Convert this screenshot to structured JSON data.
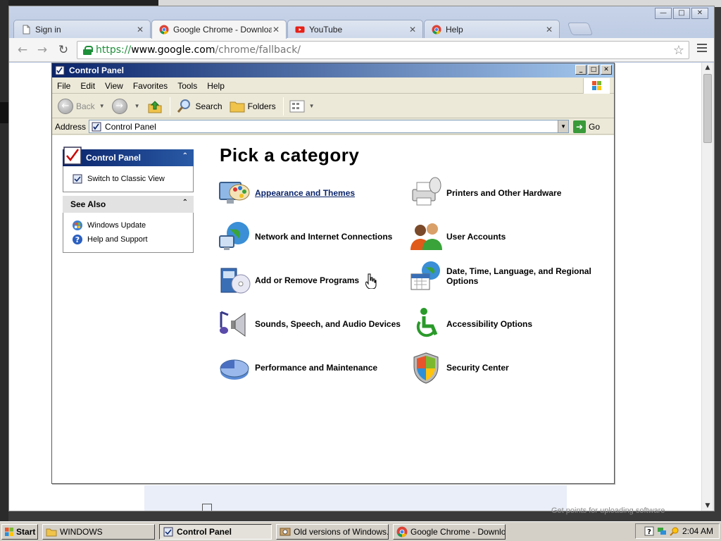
{
  "browser": {
    "tabs": [
      {
        "title": "Sign in",
        "icon": "page-icon",
        "active": false
      },
      {
        "title": "Google Chrome - Download the Fast",
        "icon": "chrome-icon",
        "active": true
      },
      {
        "title": "YouTube",
        "icon": "youtube-icon",
        "active": false
      },
      {
        "title": "Help",
        "icon": "chrome-icon",
        "active": false
      }
    ],
    "window_controls": {
      "minimize": "—",
      "maximize": "□",
      "close": "✕"
    },
    "url": {
      "scheme": "https://",
      "host": "www.google.com",
      "path": "/chrome/fallback/"
    },
    "bg_text": "Get points for uploading software"
  },
  "cp": {
    "title": "Control Panel",
    "menu": [
      "File",
      "Edit",
      "View",
      "Favorites",
      "Tools",
      "Help"
    ],
    "toolbar": {
      "back": "Back",
      "search": "Search",
      "folders": "Folders"
    },
    "address_label": "Address",
    "address_value": "Control Panel",
    "go_label": "Go",
    "taskpane": {
      "cp_title": "Control Panel",
      "switch": "Switch to Classic View",
      "see_also_title": "See Also",
      "see_also": [
        "Windows Update",
        "Help and Support"
      ]
    },
    "heading": "Pick a category",
    "categories": [
      {
        "label": "Appearance and Themes",
        "icon": "appearance-themes-icon"
      },
      {
        "label": "Printers and Other Hardware",
        "icon": "printer-icon"
      },
      {
        "label": "Network and Internet Connections",
        "icon": "network-globe-icon"
      },
      {
        "label": "User Accounts",
        "icon": "user-accounts-icon"
      },
      {
        "label": "Add or Remove Programs",
        "icon": "add-remove-programs-icon"
      },
      {
        "label": "Date, Time, Language, and Regional Options",
        "icon": "calendar-globe-icon"
      },
      {
        "label": "Sounds, Speech, and Audio Devices",
        "icon": "speaker-note-icon"
      },
      {
        "label": "Accessibility Options",
        "icon": "accessibility-icon"
      },
      {
        "label": "Performance and Maintenance",
        "icon": "pie-chart-icon"
      },
      {
        "label": "Security Center",
        "icon": "shield-icon"
      }
    ]
  },
  "taskbar": {
    "start": "Start",
    "buttons": [
      "WINDOWS",
      "Control Panel",
      "Old versions of Windows...",
      "Google Chrome - Downlo..."
    ],
    "clock": "2:04 AM"
  },
  "colors": {
    "xp_blue": "#0a246a",
    "chrome_green": "#1e8f3a",
    "taskbar": "#d4d0c8"
  }
}
